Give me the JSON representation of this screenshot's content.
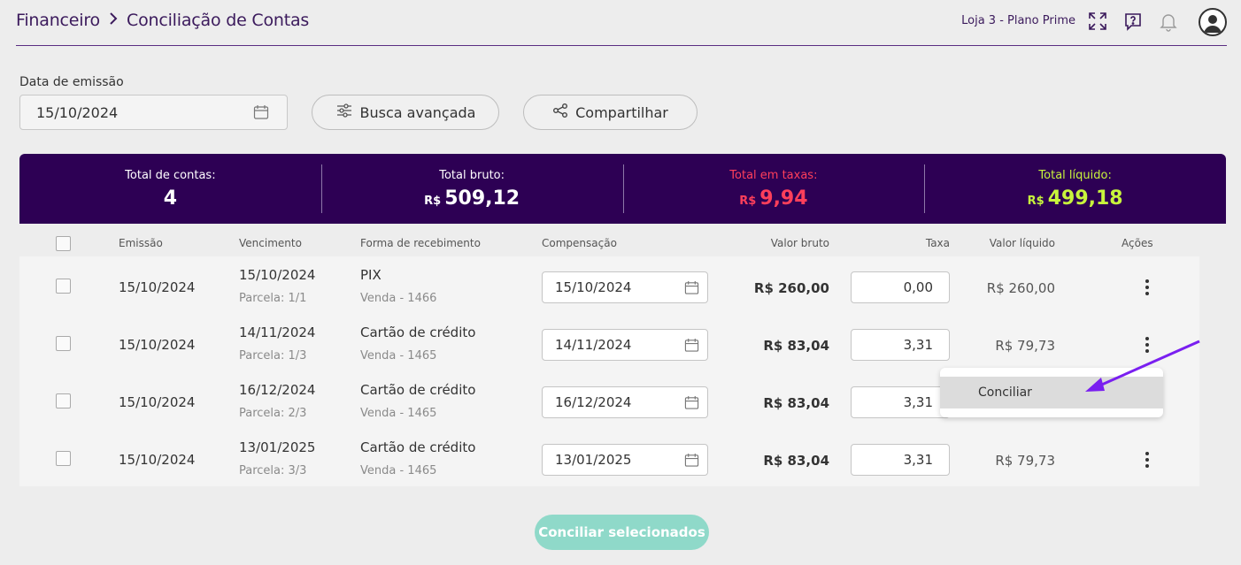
{
  "header": {
    "breadcrumb": [
      "Financeiro",
      "Conciliação de Contas"
    ],
    "store": "Loja 3 - Plano Prime"
  },
  "filters": {
    "date_label": "Data de emissão",
    "date_value": "15/10/2024",
    "advanced_search": "Busca avançada",
    "share": "Compartilhar"
  },
  "summary": {
    "total_contas_label": "Total de contas:",
    "total_contas_value": "4",
    "total_bruto_label": "Total bruto:",
    "total_bruto_currency": "R$",
    "total_bruto_value": "509,12",
    "total_taxas_label": "Total em taxas:",
    "total_taxas_currency": "R$",
    "total_taxas_value": "9,94",
    "total_liquido_label": "Total líquido:",
    "total_liquido_currency": "R$",
    "total_liquido_value": "499,18"
  },
  "table": {
    "columns": {
      "emissao": "Emissão",
      "vencimento": "Vencimento",
      "forma": "Forma de recebimento",
      "compensacao": "Compensação",
      "valor_bruto": "Valor bruto",
      "taxa": "Taxa",
      "valor_liquido": "Valor líquido",
      "acoes": "Ações"
    },
    "rows": [
      {
        "emissao": "15/10/2024",
        "vencimento": "15/10/2024",
        "parcela": "Parcela: 1/1",
        "forma": "PIX",
        "venda": "Venda - 1466",
        "compensacao": "15/10/2024",
        "valor_bruto": "R$ 260,00",
        "taxa": "0,00",
        "valor_liquido": "R$ 260,00"
      },
      {
        "emissao": "15/10/2024",
        "vencimento": "14/11/2024",
        "parcela": "Parcela: 1/3",
        "forma": "Cartão de crédito",
        "venda": "Venda - 1465",
        "compensacao": "14/11/2024",
        "valor_bruto": "R$ 83,04",
        "taxa": "3,31",
        "valor_liquido": "R$ 79,73"
      },
      {
        "emissao": "15/10/2024",
        "vencimento": "16/12/2024",
        "parcela": "Parcela: 2/3",
        "forma": "Cartão de crédito",
        "venda": "Venda - 1465",
        "compensacao": "16/12/2024",
        "valor_bruto": "R$ 83,04",
        "taxa": "3,31",
        "valor_liquido": ""
      },
      {
        "emissao": "15/10/2024",
        "vencimento": "13/01/2025",
        "parcela": "Parcela: 3/3",
        "forma": "Cartão de crédito",
        "venda": "Venda - 1465",
        "compensacao": "13/01/2025",
        "valor_bruto": "R$ 83,04",
        "taxa": "3,31",
        "valor_liquido": "R$ 79,73"
      }
    ]
  },
  "action_menu": {
    "item": "Conciliar"
  },
  "footer": {
    "conciliar_selecionados": "Conciliar selecionados"
  },
  "colors": {
    "brand_purple": "#2d0054",
    "tax_red": "#ff3f5b",
    "net_green": "#c8f53c",
    "button_teal": "#8fd9c9",
    "arrow_purple": "#7a1ff0"
  }
}
